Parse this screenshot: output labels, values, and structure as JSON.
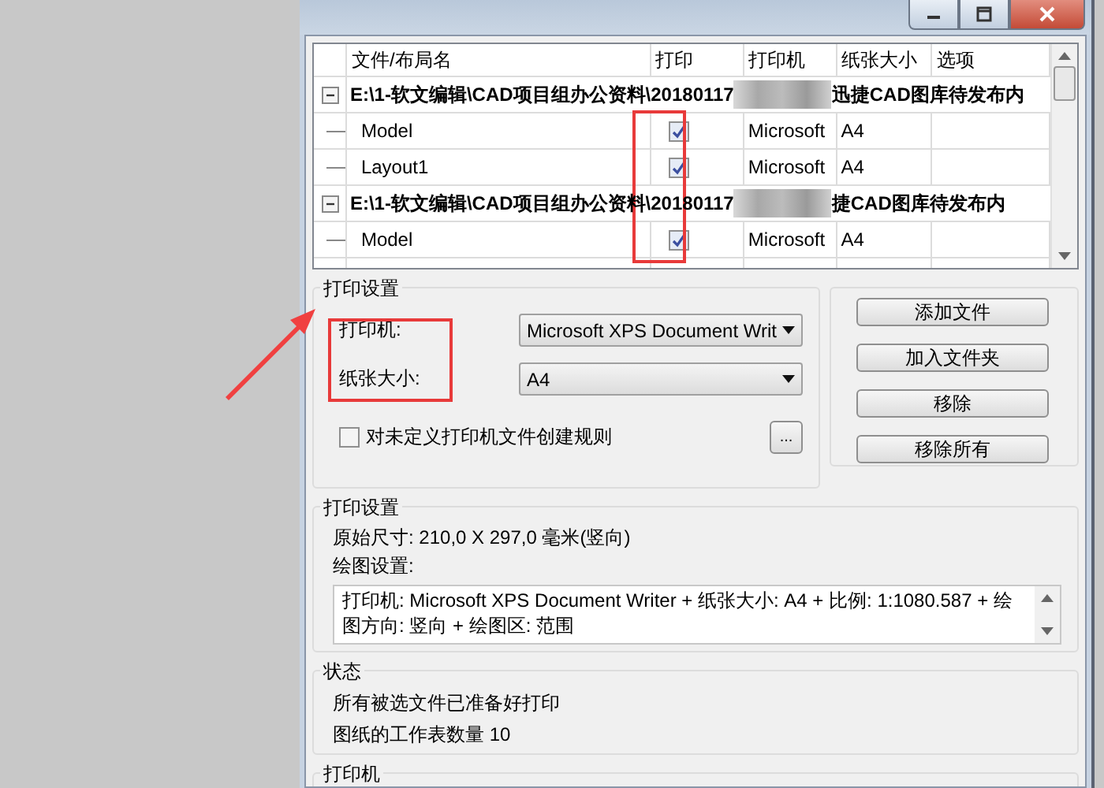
{
  "table": {
    "columns": [
      "文件/布局名",
      "打印",
      "打印机",
      "纸张大小",
      "选项"
    ],
    "rows": [
      {
        "kind": "file",
        "path_start": "E:\\1-软文编辑\\CAD项目组办公资料\\20180117",
        "path_end": "迅捷CAD图库待发布内",
        "expanded": true
      },
      {
        "kind": "layout",
        "name": "Model",
        "checked": true,
        "printer": "Microsoft",
        "paper": "A4"
      },
      {
        "kind": "layout",
        "name": "Layout1",
        "checked": true,
        "printer": "Microsoft",
        "paper": "A4"
      },
      {
        "kind": "file",
        "path_start": "E:\\1-软文编辑\\CAD项目组办公资料\\20180117",
        "path_end": "捷CAD图库待发布内",
        "expanded": true
      },
      {
        "kind": "layout",
        "name": "Model",
        "checked": true,
        "printer": "Microsoft",
        "paper": "A4"
      }
    ]
  },
  "print_settings": {
    "title": "打印设置",
    "printer_label": "打印机:",
    "printer_value": "Microsoft XPS Document Writ",
    "paper_label": "纸张大小:",
    "paper_value": "A4",
    "rule_checkbox": {
      "label": "对未定义打印机文件创建规则",
      "checked": false
    },
    "more_button": "..."
  },
  "buttons": [
    "添加文件",
    "加入文件夹",
    "移除",
    "移除所有"
  ],
  "plot_settings": {
    "title": "打印设置",
    "original_size": "原始尺寸: 210,0 X 297,0 毫米(竖向)",
    "drawing_label": "绘图设置:",
    "drawing_text": "打印机: Microsoft XPS Document Writer + 纸张大小: A4 + 比例: 1:1080.587 + 绘图方向: 竖向 + 绘图区: 范围"
  },
  "status": {
    "title": "状态",
    "lines": [
      "所有被选文件已准备好打印",
      "图纸的工作表数量 10"
    ]
  },
  "printer_section": {
    "title": "打印机"
  },
  "annotations": [
    {
      "kind": "box"
    },
    {
      "kind": "box"
    },
    {
      "kind": "arrow"
    }
  ]
}
